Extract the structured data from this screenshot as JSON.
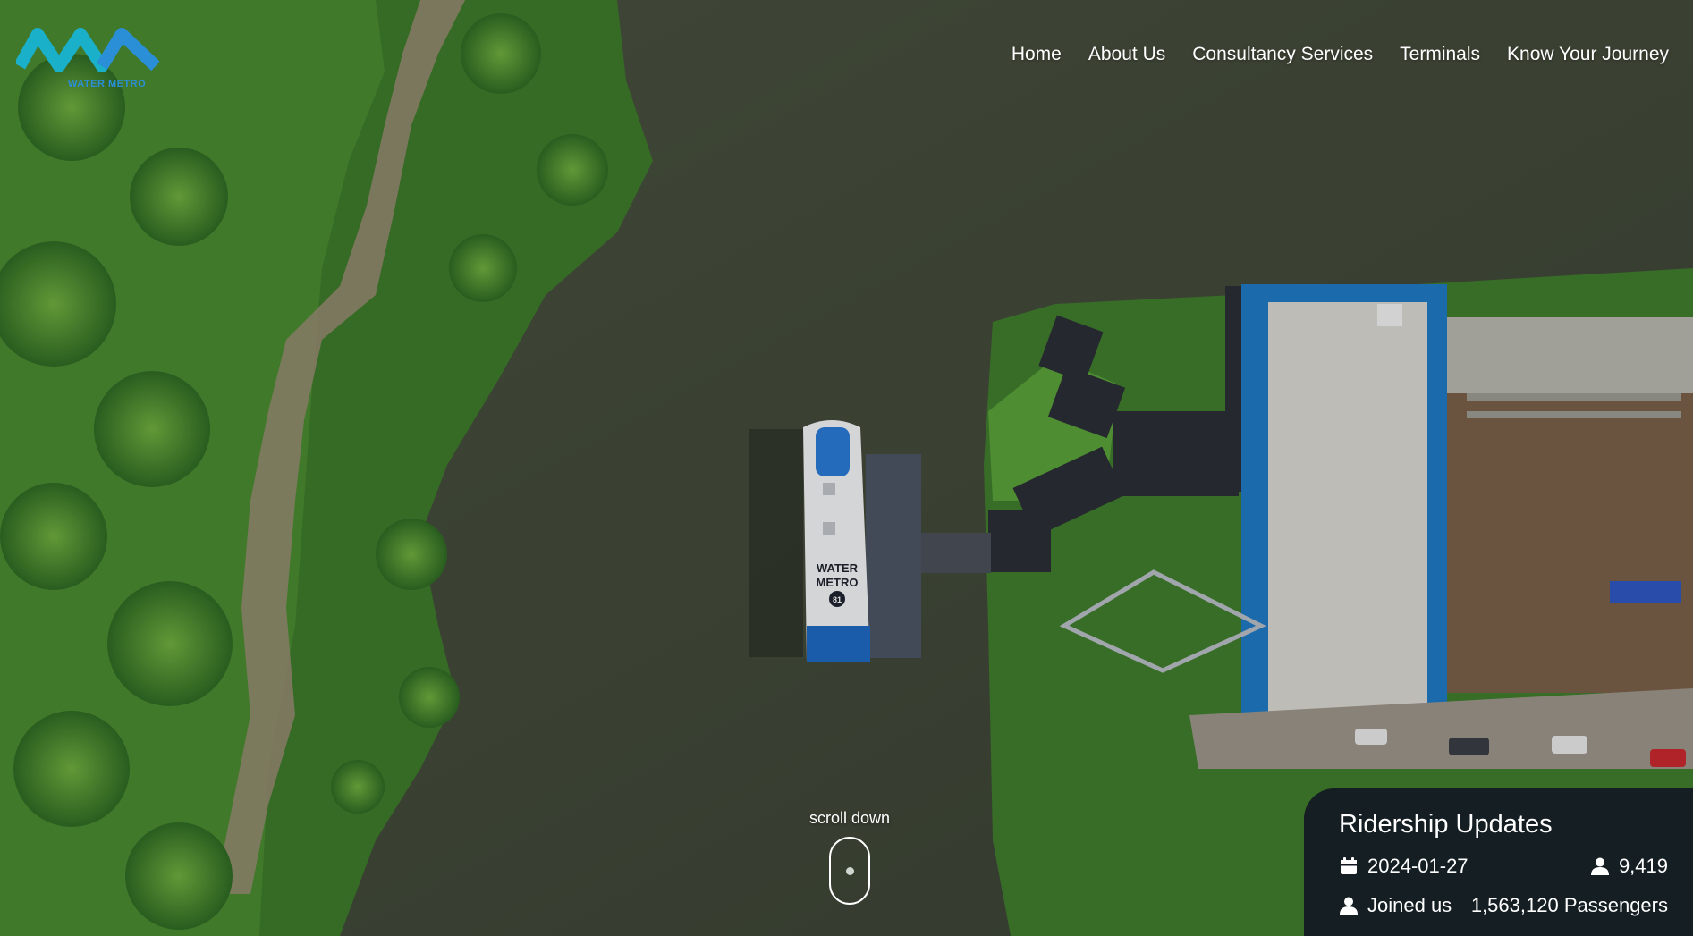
{
  "brand": {
    "logo_icon": "water-metro-logo",
    "logo_text": "WATER METRO",
    "primary_color": "#1ab0c9",
    "accent_color": "#2a8fd6"
  },
  "nav": {
    "items": [
      {
        "label": "Home"
      },
      {
        "label": "About Us"
      },
      {
        "label": "Consultancy Services"
      },
      {
        "label": "Terminals"
      },
      {
        "label": "Know Your Journey"
      }
    ]
  },
  "hero": {
    "scroll_label": "scroll down",
    "scroll_icon": "mouse-scroll-icon",
    "boat": {
      "text_line1": "WATER",
      "text_line2": "METRO",
      "badge": "81"
    }
  },
  "ridership": {
    "title": "Ridership Updates",
    "date": "2024-01-27",
    "date_icon": "calendar-icon",
    "daily_count": "9,419",
    "daily_icon": "user-icon",
    "joined_label": "Joined us",
    "joined_icon": "user-icon",
    "total_passengers": "1,563,120 Passengers",
    "panel_color": "#121822"
  }
}
